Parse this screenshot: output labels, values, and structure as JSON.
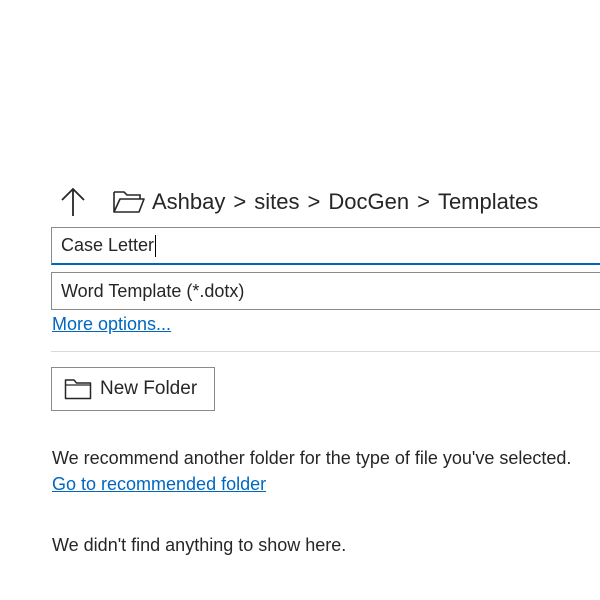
{
  "navigation": {
    "breadcrumb": [
      "Ashbay",
      "sites",
      "DocGen",
      "Templates"
    ],
    "separator": ">",
    "up_icon": "arrow-up-icon",
    "folder_icon": "folder-open-icon"
  },
  "filename": {
    "value": "Case Letter"
  },
  "filetype": {
    "selected": "Word Template (*.dotx)"
  },
  "more_options_label": "More options...",
  "new_folder": {
    "label": "New Folder",
    "icon": "folder-icon"
  },
  "recommendation": {
    "text": "We recommend another folder for the type of file you've selected.",
    "link": "Go to recommended folder"
  },
  "empty_message": "We didn't find anything to show here.",
  "colors": {
    "link": "#0067c0",
    "focus_border": "#0067c0",
    "text": "#262626"
  }
}
